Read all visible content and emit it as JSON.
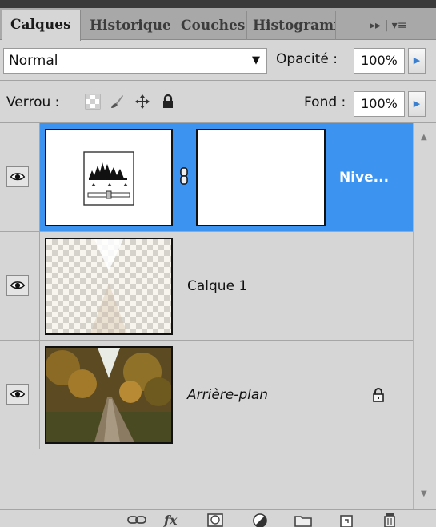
{
  "tabs": [
    {
      "label": "Calques",
      "active": true
    },
    {
      "label": "Historique",
      "active": false
    },
    {
      "label": "Couches",
      "active": false
    },
    {
      "label": "Histogramme",
      "active": false
    }
  ],
  "tab_menu_label": "▸▸ | ▾≡",
  "blend": {
    "mode": "Normal",
    "opacity_label": "Opacité :",
    "opacity_value": "100%"
  },
  "lock": {
    "label": "Verrou :",
    "fill_label": "Fond :",
    "fill_value": "100%"
  },
  "layers": [
    {
      "name": "Nive...",
      "type": "adjustment-levels",
      "selected": true,
      "visible": true,
      "locked": false,
      "italic": false
    },
    {
      "name": "Calque 1",
      "type": "pixel-transparent",
      "selected": false,
      "visible": true,
      "locked": false,
      "italic": false
    },
    {
      "name": "Arrière-plan",
      "type": "background-photo",
      "selected": false,
      "visible": true,
      "locked": true,
      "italic": true
    }
  ],
  "bottom_icons": [
    "link-icon",
    "fx-icon",
    "mask-icon",
    "adjustment-icon",
    "folder-icon",
    "new-layer-icon",
    "trash-icon"
  ],
  "colors": {
    "selection": "#3d93f0",
    "panel": "#d6d6d6",
    "tabbar": "#a8a8a8",
    "spin_arrow": "#3a7fd0"
  }
}
